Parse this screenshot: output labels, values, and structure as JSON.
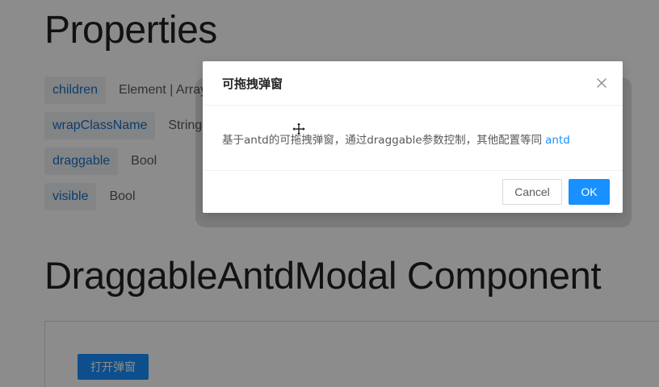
{
  "properties": {
    "heading": "Properties",
    "rows": [
      {
        "name": "children",
        "type": "Element | Array"
      },
      {
        "name": "wrapClassName",
        "type": "String"
      },
      {
        "name": "draggable",
        "type": "Bool"
      },
      {
        "name": "visible",
        "type": "Bool"
      }
    ]
  },
  "component": {
    "heading": "DraggableAntdModal Component",
    "open_button_label": "打开弹窗"
  },
  "modal": {
    "title": "可拖拽弹窗",
    "body_text": "基于antd的可拖拽弹窗，通过draggable参数控制，其他配置等同",
    "body_link": "antd",
    "cancel_label": "Cancel",
    "ok_label": "OK"
  },
  "colors": {
    "primary": "#1890ff",
    "link": "#1770c9",
    "mask": "rgba(0,0,0,0.45)"
  },
  "icons": {
    "close": "close-icon",
    "cursor": "move-cursor-icon"
  }
}
